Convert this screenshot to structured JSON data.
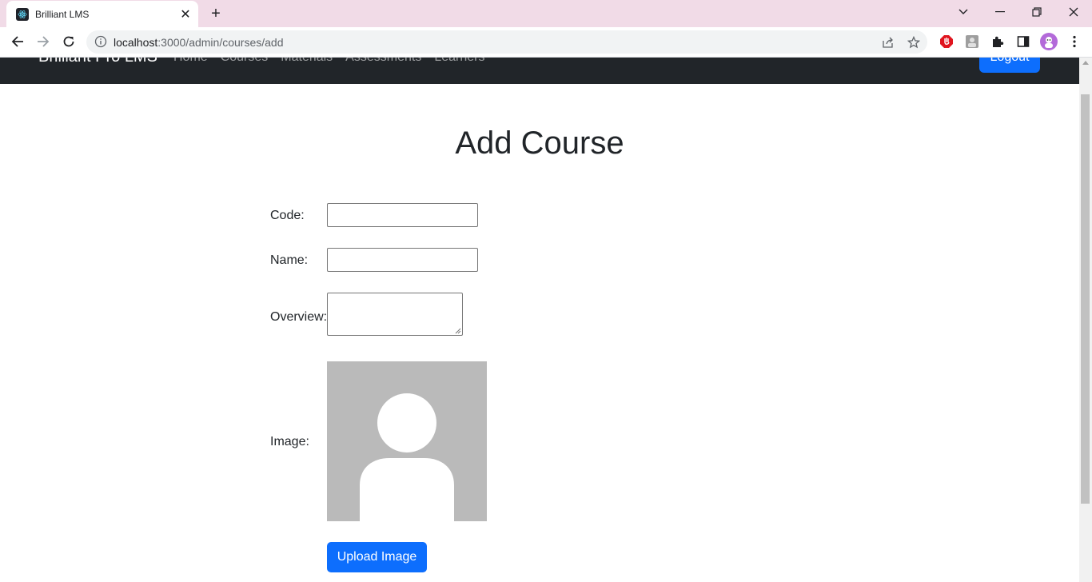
{
  "browser": {
    "tab_title": "Brilliant LMS",
    "url_host": "localhost",
    "url_path": ":3000/admin/courses/add"
  },
  "navbar": {
    "brand": "Brilliant Pro LMS",
    "links": [
      "Home",
      "Courses",
      "Materials",
      "Assessments",
      "Learners"
    ],
    "logout_label": "Logout"
  },
  "page": {
    "title": "Add Course",
    "form": {
      "code_label": "Code:",
      "code_value": "",
      "name_label": "Name:",
      "name_value": "",
      "overview_label": "Overview:",
      "overview_value": "",
      "image_label": "Image:",
      "upload_label": "Upload Image"
    }
  },
  "colors": {
    "primary": "#0d6efd",
    "navbar_bg": "#212529",
    "placeholder_bg": "#bababa"
  }
}
